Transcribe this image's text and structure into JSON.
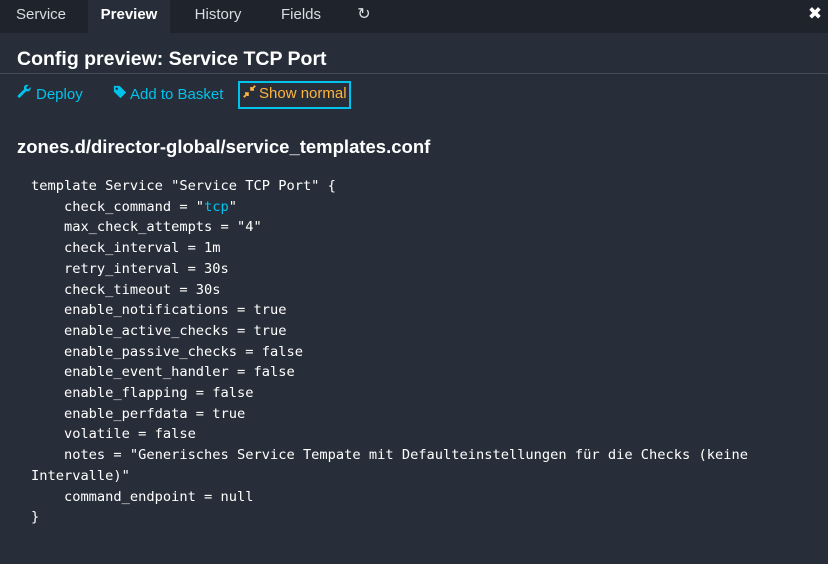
{
  "tabs": [
    {
      "label": "Service"
    },
    {
      "label": "Preview"
    },
    {
      "label": "History"
    },
    {
      "label": "Fields"
    }
  ],
  "tab_refresh_icon": "↻",
  "close_icon": "✖",
  "page_title": "Config preview: Service TCP Port",
  "actions": {
    "deploy": "Deploy",
    "add_to_basket": "Add to Basket",
    "show_normal": "Show normal"
  },
  "file_title": "zones.d/director-global/service_templates.conf",
  "code": {
    "line1": "template Service \"Service TCP Port\" {",
    "check_command_prefix": "    check_command = \"",
    "check_command_value": "tcp",
    "check_command_suffix": "\"",
    "lines": [
      "    max_check_attempts = \"4\"",
      "    check_interval = 1m",
      "    retry_interval = 30s",
      "    check_timeout = 30s",
      "    enable_notifications = true",
      "    enable_active_checks = true",
      "    enable_passive_checks = false",
      "    enable_event_handler = false",
      "    enable_flapping = false",
      "    enable_perfdata = true",
      "    volatile = false",
      "    notes = \"Generisches Service Tempate mit Defaulteinstellungen für die Checks (keine",
      "Intervalle)\"",
      "    command_endpoint = null",
      "}"
    ]
  },
  "colors": {
    "background": "#282e39",
    "tabbar": "#1e232c",
    "link": "#00c3ed",
    "active_toggle": "#ffb43c"
  }
}
